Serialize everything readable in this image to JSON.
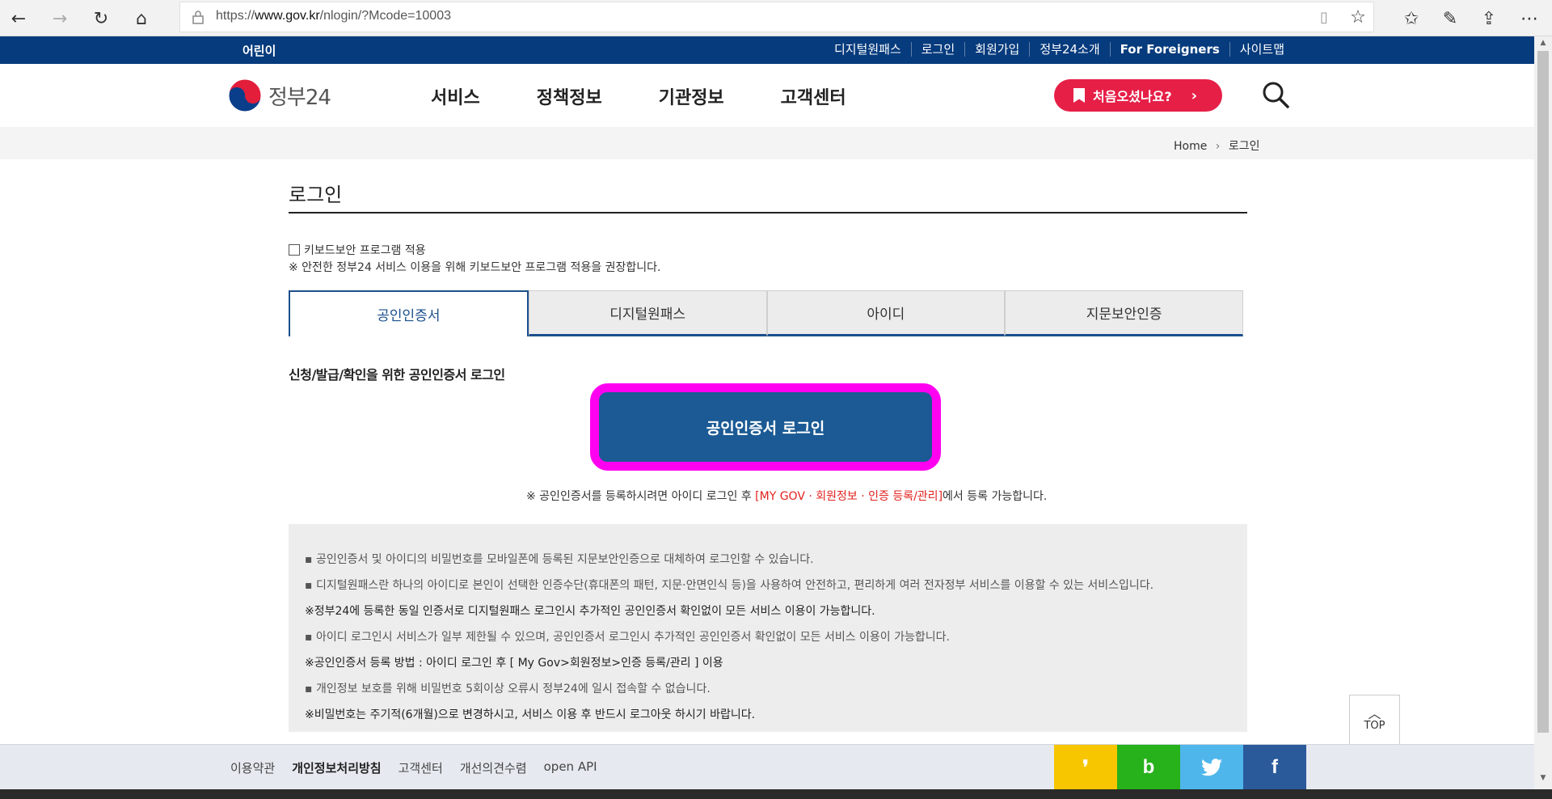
{
  "browser": {
    "url_prefix": "https://",
    "url_host": "www.gov.kr",
    "url_path": "/nlogin/?Mcode=10003",
    "back_icon": "arrow-left-icon",
    "forward_icon": "arrow-right-icon",
    "refresh_icon": "refresh-icon",
    "home_icon": "home-icon"
  },
  "util_bar": {
    "kids": "어린이",
    "links": [
      "디지털원패스",
      "로그인",
      "회원가입",
      "정부24소개",
      "For Foreigners",
      "사이트맵"
    ]
  },
  "header": {
    "logo_text": "정부24",
    "gnb": [
      "서비스",
      "정책정보",
      "기관정보",
      "고객센터"
    ],
    "first_visit": "처음오셨나요?",
    "first_visit_arrow": "›"
  },
  "breadcrumb": {
    "home": "Home",
    "sep": "›",
    "current": "로그인"
  },
  "page": {
    "title": "로그인",
    "keyboard_security_label": "키보드보안 프로그램 적용",
    "keyboard_security_note": "※ 안전한 정부24 서비스 이용을 위해 키보드보안 프로그램 적용을 권장합니다."
  },
  "tabs": [
    "공인인증서",
    "디지털원패스",
    "아이디",
    "지문보안인증"
  ],
  "cert_section": {
    "heading": "신청/발급/확인을 위한 공인인증서 로그인",
    "login_button": "공인인증서 로그인",
    "note_before": "※ 공인인증서를 등록하시려면 아이디 로그인 후 ",
    "note_link": "[MY GOV · 회원정보 · 인증 등록/관리]",
    "note_after": "에서 등록 가능합니다."
  },
  "info_lines": [
    "▪ 공인인증서 및 아이디의 비밀번호를 모바일폰에 등록된 지문보안인증으로 대체하여 로그인할 수 있습니다.",
    "▪ 디지털원패스란 하나의 아이디로 본인이 선택한 인증수단(휴대폰의 패턴, 지문·안면인식 등)을 사용하여 안전하고, 편리하게 여러 전자정부 서비스를 이용할 수 있는 서비스입니다.",
    "※정부24에 등록한 동일 인증서로 디지털원패스 로그인시 추가적인 공인인증서 확인없이 모든 서비스 이용이 가능합니다.",
    "▪ 아이디 로그인시 서비스가 일부 제한될 수 있으며, 공인인증서 로그인시 추가적인 공인인증서 확인없이 모든 서비스 이용이 가능합니다.",
    "※공인인증서 등록 방법 : 아이디 로그인 후 [ My Gov>회원정보>인증 등록/관리 ] 이용",
    "▪ 개인정보 보호를 위해 비밀번호 5회이상 오류시 정부24에 일시 접속할 수 없습니다.",
    "※비밀번호는 주기적(6개월)으로 변경하시고, 서비스 이용 후 반드시 로그아웃 하시기 바랍니다."
  ],
  "top_button": "TOP",
  "footer": {
    "links": [
      "이용약관",
      "개인정보처리방침",
      "고객센터",
      "개선의견수렴",
      "open API"
    ]
  },
  "sns": [
    {
      "name": "kakaostory-icon",
      "glyph": "❜",
      "color": "#f7c600"
    },
    {
      "name": "band-icon",
      "glyph": "b",
      "color": "#27b11b"
    },
    {
      "name": "twitter-icon",
      "glyph": "🐦",
      "color": "#4fb6ec"
    },
    {
      "name": "facebook-icon",
      "glyph": "f",
      "color": "#2a5a9a"
    }
  ],
  "colors": {
    "util_bar": "#063b7d",
    "accent_red": "#e61f47",
    "button_blue": "#1b5a94",
    "highlight": "#ff00f0"
  }
}
